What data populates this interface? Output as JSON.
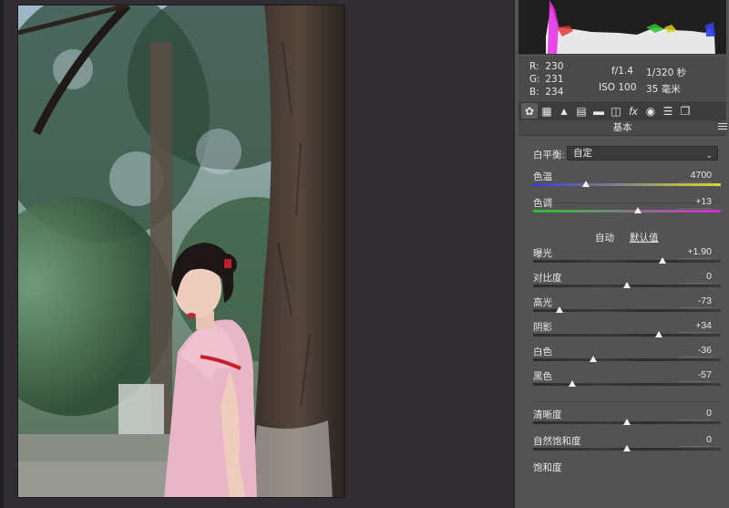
{
  "info": {
    "r_label": "R:",
    "r_value": "230",
    "g_label": "G:",
    "g_value": "231",
    "b_label": "B:",
    "b_value": "234",
    "aperture": "f/1.4",
    "shutter": "1/320 秒",
    "iso": "ISO 100",
    "focal": "35 毫米"
  },
  "tabs": [
    {
      "icon": "aperture-icon",
      "glyph": "✿"
    },
    {
      "icon": "grid-icon",
      "glyph": "▦"
    },
    {
      "icon": "mountain-icon",
      "glyph": "▲"
    },
    {
      "icon": "hsl-icon",
      "glyph": "▤"
    },
    {
      "icon": "split-tone-icon",
      "glyph": "▬"
    },
    {
      "icon": "lens-icon",
      "glyph": "◫"
    },
    {
      "icon": "fx-icon",
      "glyph": "fx"
    },
    {
      "icon": "camera-icon",
      "glyph": "◉"
    },
    {
      "icon": "presets-icon",
      "glyph": "☰"
    },
    {
      "icon": "snapshots-icon",
      "glyph": "❐"
    }
  ],
  "section_title": "基本",
  "white_balance": {
    "label": "白平衡:",
    "value": "自定"
  },
  "auto_label": "自动",
  "default_label": "默认值",
  "sliders": [
    {
      "name": "色温",
      "value": "4700",
      "position": 0.28,
      "track": "temp"
    },
    {
      "name": "色调",
      "value": "+13",
      "position": 0.56,
      "track": "tint"
    },
    {
      "name": "曝光",
      "value": "+1.90",
      "position": 0.69,
      "track": "plain"
    },
    {
      "name": "对比度",
      "value": "0",
      "position": 0.5,
      "track": "plain"
    },
    {
      "name": "高光",
      "value": "-73",
      "position": 0.14,
      "track": "plain"
    },
    {
      "name": "阴影",
      "value": "+34",
      "position": 0.67,
      "track": "plain"
    },
    {
      "name": "白色",
      "value": "-36",
      "position": 0.32,
      "track": "plain"
    },
    {
      "name": "黑色",
      "value": "-57",
      "position": 0.21,
      "track": "plain"
    },
    {
      "name": "清晰度",
      "value": "0",
      "position": 0.5,
      "track": "plain"
    },
    {
      "name": "自然饱和度",
      "value": "0",
      "position": 0.5,
      "track": "plain"
    },
    {
      "name": "饱和度",
      "value": "",
      "position": 0.5,
      "track": "none"
    }
  ],
  "colors": {
    "panel_bg": "#535353",
    "canvas_bg": "#312e33",
    "temp_gradient": [
      "#3b3bd0",
      "#d8d830"
    ],
    "tint_gradient": [
      "#30c030",
      "#d030d0"
    ]
  }
}
